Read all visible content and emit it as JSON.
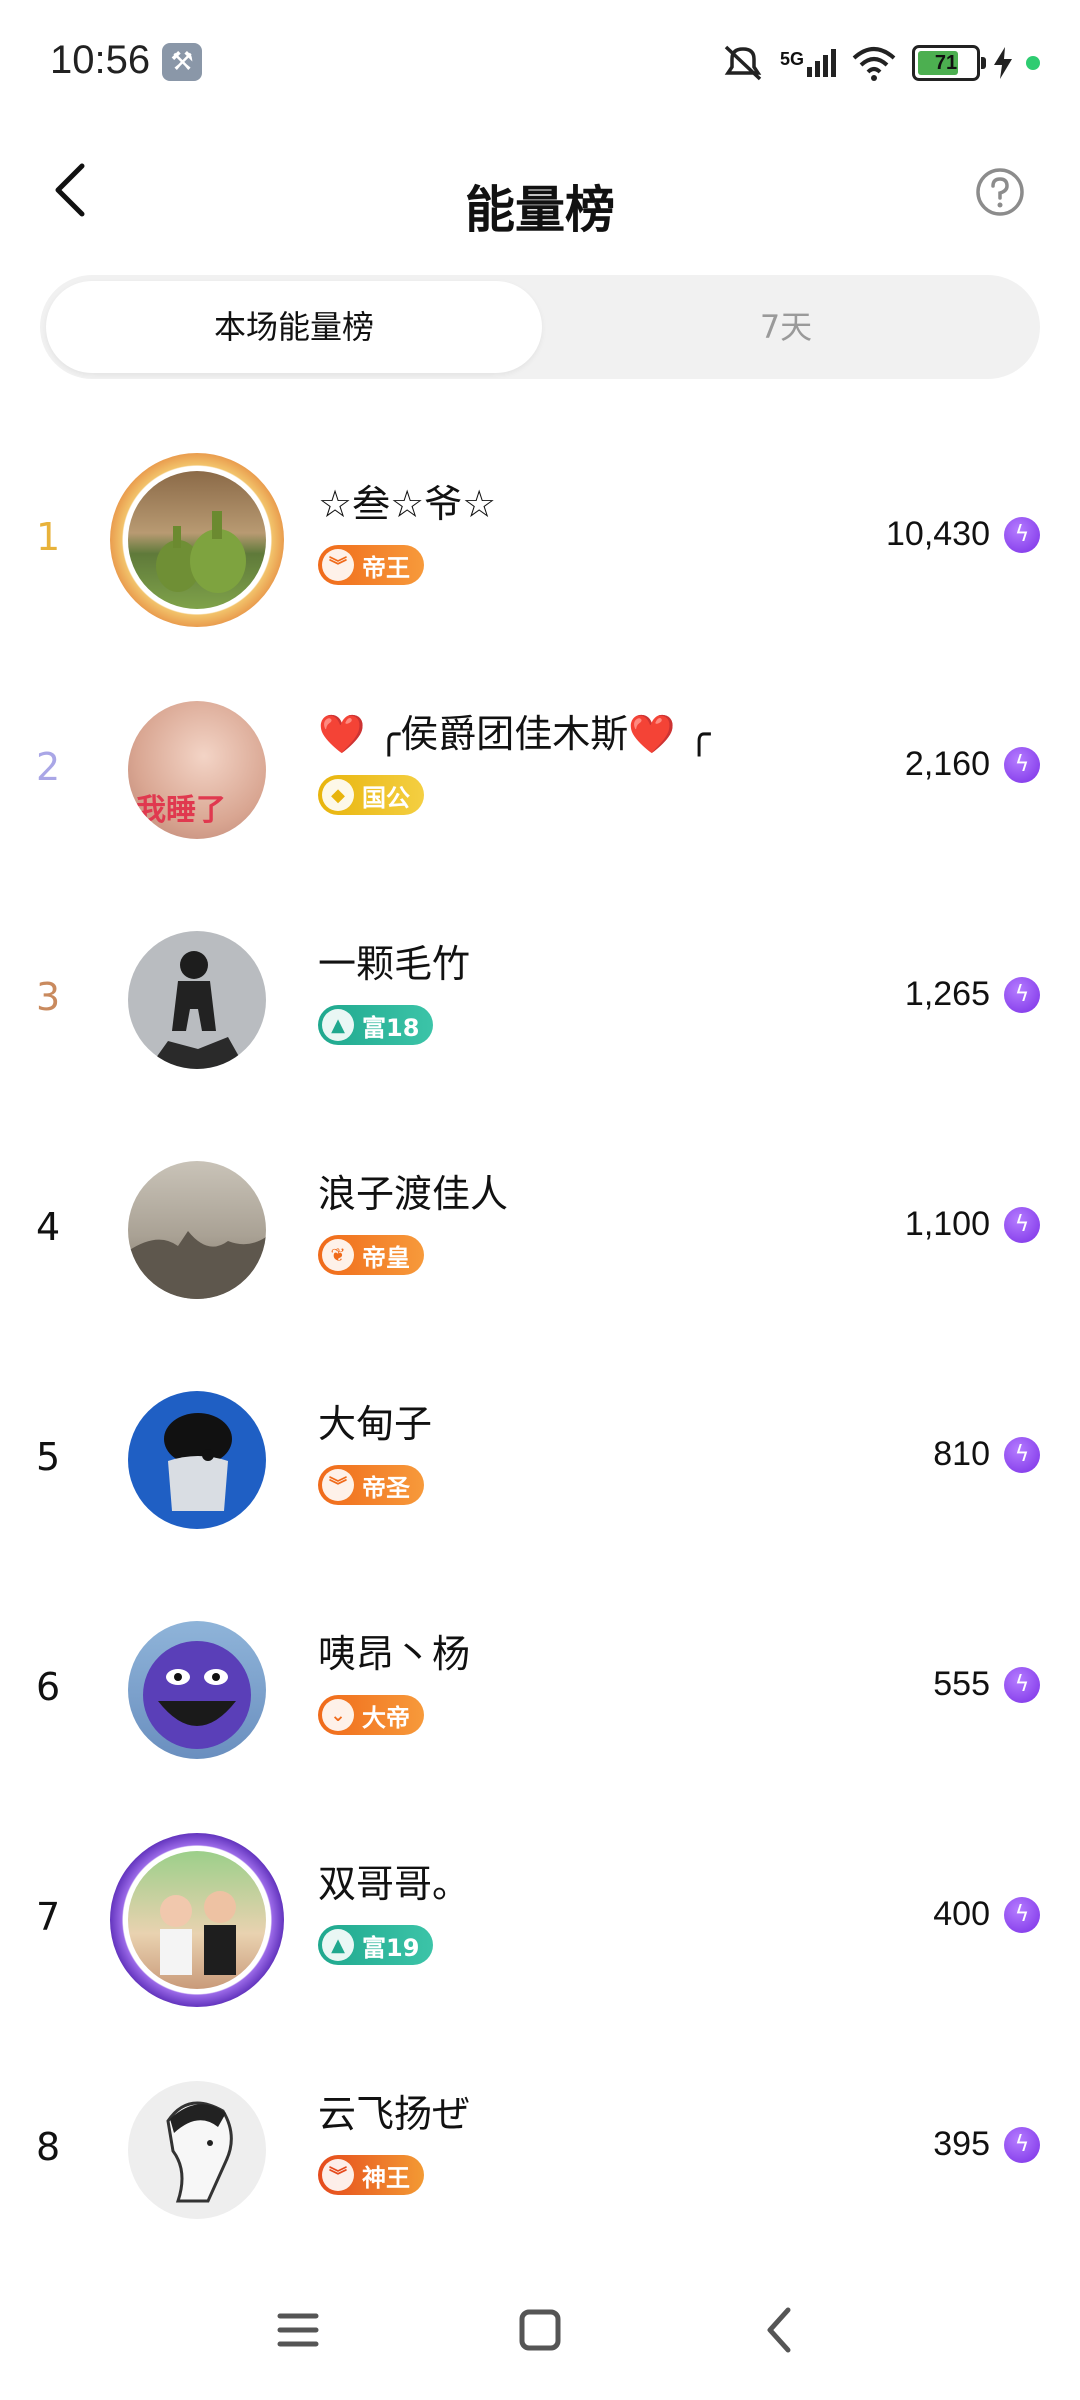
{
  "status": {
    "time": "10:56",
    "network": "5G",
    "battery": "71",
    "battery_percent": 71
  },
  "header": {
    "title": "能量榜",
    "back_icon": "chevron-left-icon",
    "help_icon": "question-circle-icon"
  },
  "tabs": [
    {
      "label": "本场能量榜",
      "active": true
    },
    {
      "label": "7天",
      "active": false
    }
  ],
  "leaderboard": [
    {
      "rank": "1",
      "name": "☆叁☆爷☆",
      "badge": "帝王",
      "score": "10,430"
    },
    {
      "rank": "2",
      "name": "❤️ ╭侯爵团佳木斯❤️ ╭",
      "badge": "国公",
      "score": "2,160"
    },
    {
      "rank": "3",
      "name": "一颗毛竹",
      "badge": "富18",
      "score": "1,265"
    },
    {
      "rank": "4",
      "name": "浪子渡佳人",
      "badge": "帝皇",
      "score": "1,100"
    },
    {
      "rank": "5",
      "name": "大甸子",
      "badge": "帝圣",
      "score": "810"
    },
    {
      "rank": "6",
      "name": "咦昂丶杨",
      "badge": "大帝",
      "score": "555"
    },
    {
      "rank": "7",
      "name": "双哥哥。",
      "badge": "富19",
      "score": "400"
    },
    {
      "rank": "8",
      "name": "云飞扬ぜ",
      "badge": "神王",
      "score": "395"
    }
  ],
  "avatar_texts": {
    "row2": "我睡了"
  },
  "colors": {
    "rank1": "#e8b23a",
    "rank2": "#a9a6e6",
    "rank3": "#c98a5e",
    "rank_default": "#111111",
    "badge_orange": "#f0701f",
    "badge_gold": "#e8b40c",
    "badge_teal": "#27b39a",
    "badge_red": "#e54a1c",
    "energy_purple": "#8a3cf0"
  }
}
